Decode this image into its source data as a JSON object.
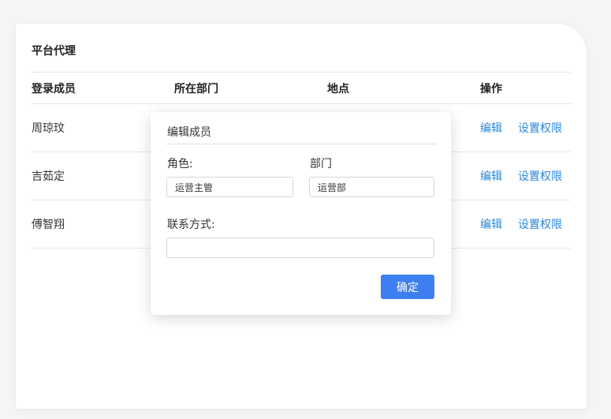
{
  "card": {
    "title": "平台代理"
  },
  "table": {
    "headers": [
      "登录成员",
      "所在部门",
      "地点",
      "操作"
    ],
    "rows": [
      {
        "name": "周琼玟"
      },
      {
        "name": "吉茹定"
      },
      {
        "name": "傅智翔"
      }
    ],
    "actions": {
      "edit": "编辑",
      "permissions": "设置权限"
    }
  },
  "modal": {
    "title": "编辑成员",
    "role_label": "角色:",
    "role_value": "运营主管",
    "dept_label": "部门",
    "dept_value": "运营部",
    "contact_label": "联系方式:",
    "contact_value": "",
    "confirm": "确定"
  },
  "colors": {
    "accent": "#3d7ff0",
    "link": "#2a86d6"
  }
}
